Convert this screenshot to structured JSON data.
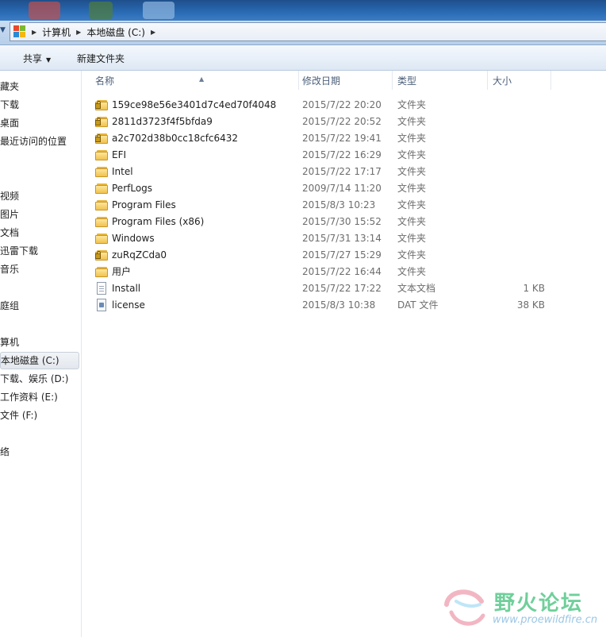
{
  "address_bar": {
    "crumbs": [
      "计算机",
      "本地磁盘 (C:)"
    ]
  },
  "toolbar": {
    "share_label": "共享",
    "new_folder_label": "新建文件夹"
  },
  "sidebar": {
    "items": [
      {
        "label": "藏夹"
      },
      {
        "label": "下载"
      },
      {
        "label": "桌面"
      },
      {
        "label": "最近访问的位置"
      },
      {
        "label": "视频"
      },
      {
        "label": "图片"
      },
      {
        "label": "文档"
      },
      {
        "label": "迅雷下载"
      },
      {
        "label": "音乐"
      },
      {
        "label": "庭组"
      },
      {
        "label": "算机"
      },
      {
        "label": "本地磁盘 (C:)"
      },
      {
        "label": "下载、娱乐 (D:)"
      },
      {
        "label": "工作资料 (E:)"
      },
      {
        "label": "文件 (F:)"
      },
      {
        "label": "络"
      }
    ],
    "selected": "本地磁盘 (C:)"
  },
  "columns": {
    "name": "名称",
    "date": "修改日期",
    "type": "类型",
    "size": "大小"
  },
  "files": [
    {
      "name": "159ce98e56e3401d7c4ed70f4048",
      "date": "2015/7/22 20:20",
      "type": "文件夹",
      "size": "",
      "icon": "locked-folder-icon"
    },
    {
      "name": "2811d3723f4f5bfda9",
      "date": "2015/7/22 20:52",
      "type": "文件夹",
      "size": "",
      "icon": "locked-folder-icon"
    },
    {
      "name": "a2c702d38b0cc18cfc6432",
      "date": "2015/7/22 19:41",
      "type": "文件夹",
      "size": "",
      "icon": "locked-folder-icon"
    },
    {
      "name": "EFI",
      "date": "2015/7/22 16:29",
      "type": "文件夹",
      "size": "",
      "icon": "folder-icon"
    },
    {
      "name": "Intel",
      "date": "2015/7/22 17:17",
      "type": "文件夹",
      "size": "",
      "icon": "folder-icon"
    },
    {
      "name": "PerfLogs",
      "date": "2009/7/14 11:20",
      "type": "文件夹",
      "size": "",
      "icon": "folder-icon"
    },
    {
      "name": "Program Files",
      "date": "2015/8/3 10:23",
      "type": "文件夹",
      "size": "",
      "icon": "folder-icon"
    },
    {
      "name": "Program Files (x86)",
      "date": "2015/7/30 15:52",
      "type": "文件夹",
      "size": "",
      "icon": "folder-icon"
    },
    {
      "name": "Windows",
      "date": "2015/7/31 13:14",
      "type": "文件夹",
      "size": "",
      "icon": "folder-icon"
    },
    {
      "name": "zuRqZCda0",
      "date": "2015/7/27 15:29",
      "type": "文件夹",
      "size": "",
      "icon": "locked-folder-icon"
    },
    {
      "name": "用户",
      "date": "2015/7/22 16:44",
      "type": "文件夹",
      "size": "",
      "icon": "folder-icon"
    },
    {
      "name": "Install",
      "date": "2015/7/22 17:22",
      "type": "文本文档",
      "size": "1 KB",
      "icon": "text-document-icon"
    },
    {
      "name": "license",
      "date": "2015/8/3 10:38",
      "type": "DAT 文件",
      "size": "38 KB",
      "icon": "dat-file-icon"
    }
  ],
  "watermark": {
    "title": "野火论坛",
    "url": "www.proewildfire.cn"
  },
  "colors": {
    "folder": "#f1c24f",
    "watermark_green": "#6fcf9a",
    "watermark_blue": "#9bc7e6"
  }
}
